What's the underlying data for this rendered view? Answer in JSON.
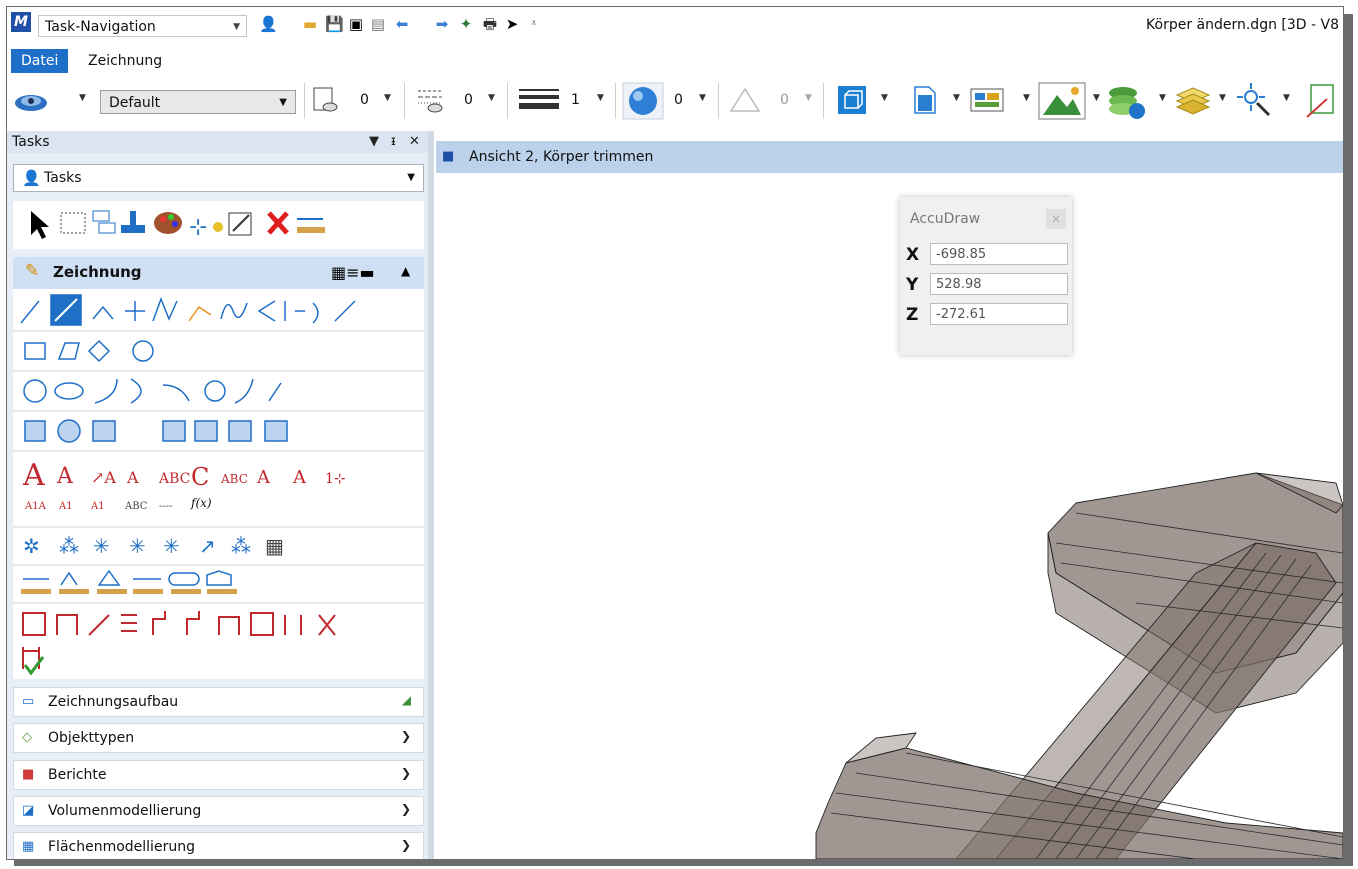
{
  "app": {
    "workflow_value": "Task-Navigation",
    "document_title": "Körper ändern.dgn [3D - V8"
  },
  "menu_tabs": [
    {
      "label": "Datei",
      "active": true
    },
    {
      "label": "Zeichnung",
      "active": false
    }
  ],
  "ribbon": {
    "active_level": "Default",
    "counters": [
      "0",
      "0",
      "1",
      "0",
      "0"
    ]
  },
  "tasks_panel": {
    "header": "Tasks",
    "selector_value": "Tasks",
    "active_group": "Zeichnung",
    "sections": [
      {
        "label": "Zeichnungsaufbau",
        "icon": "drawing-setup-icon"
      },
      {
        "label": "Objekttypen",
        "icon": "element-types-icon"
      },
      {
        "label": "Berichte",
        "icon": "reports-icon"
      },
      {
        "label": "Volumenmodellierung",
        "icon": "solid-modeling-icon"
      },
      {
        "label": "Flächenmodellierung",
        "icon": "surface-modeling-icon"
      }
    ]
  },
  "view": {
    "title": "Ansicht 2, Körper trimmen"
  },
  "accudraw": {
    "title": "AccuDraw",
    "x_label": "X",
    "y_label": "Y",
    "z_label": "Z",
    "x_value": "-698.85",
    "y_value": "528.98",
    "z_value": "-272.61"
  },
  "colors": {
    "accent": "#1e6fc7",
    "panel_bg": "#e7eef7",
    "view_title_bg": "#bcd2ea",
    "solid_fill": "#7d6f68"
  }
}
